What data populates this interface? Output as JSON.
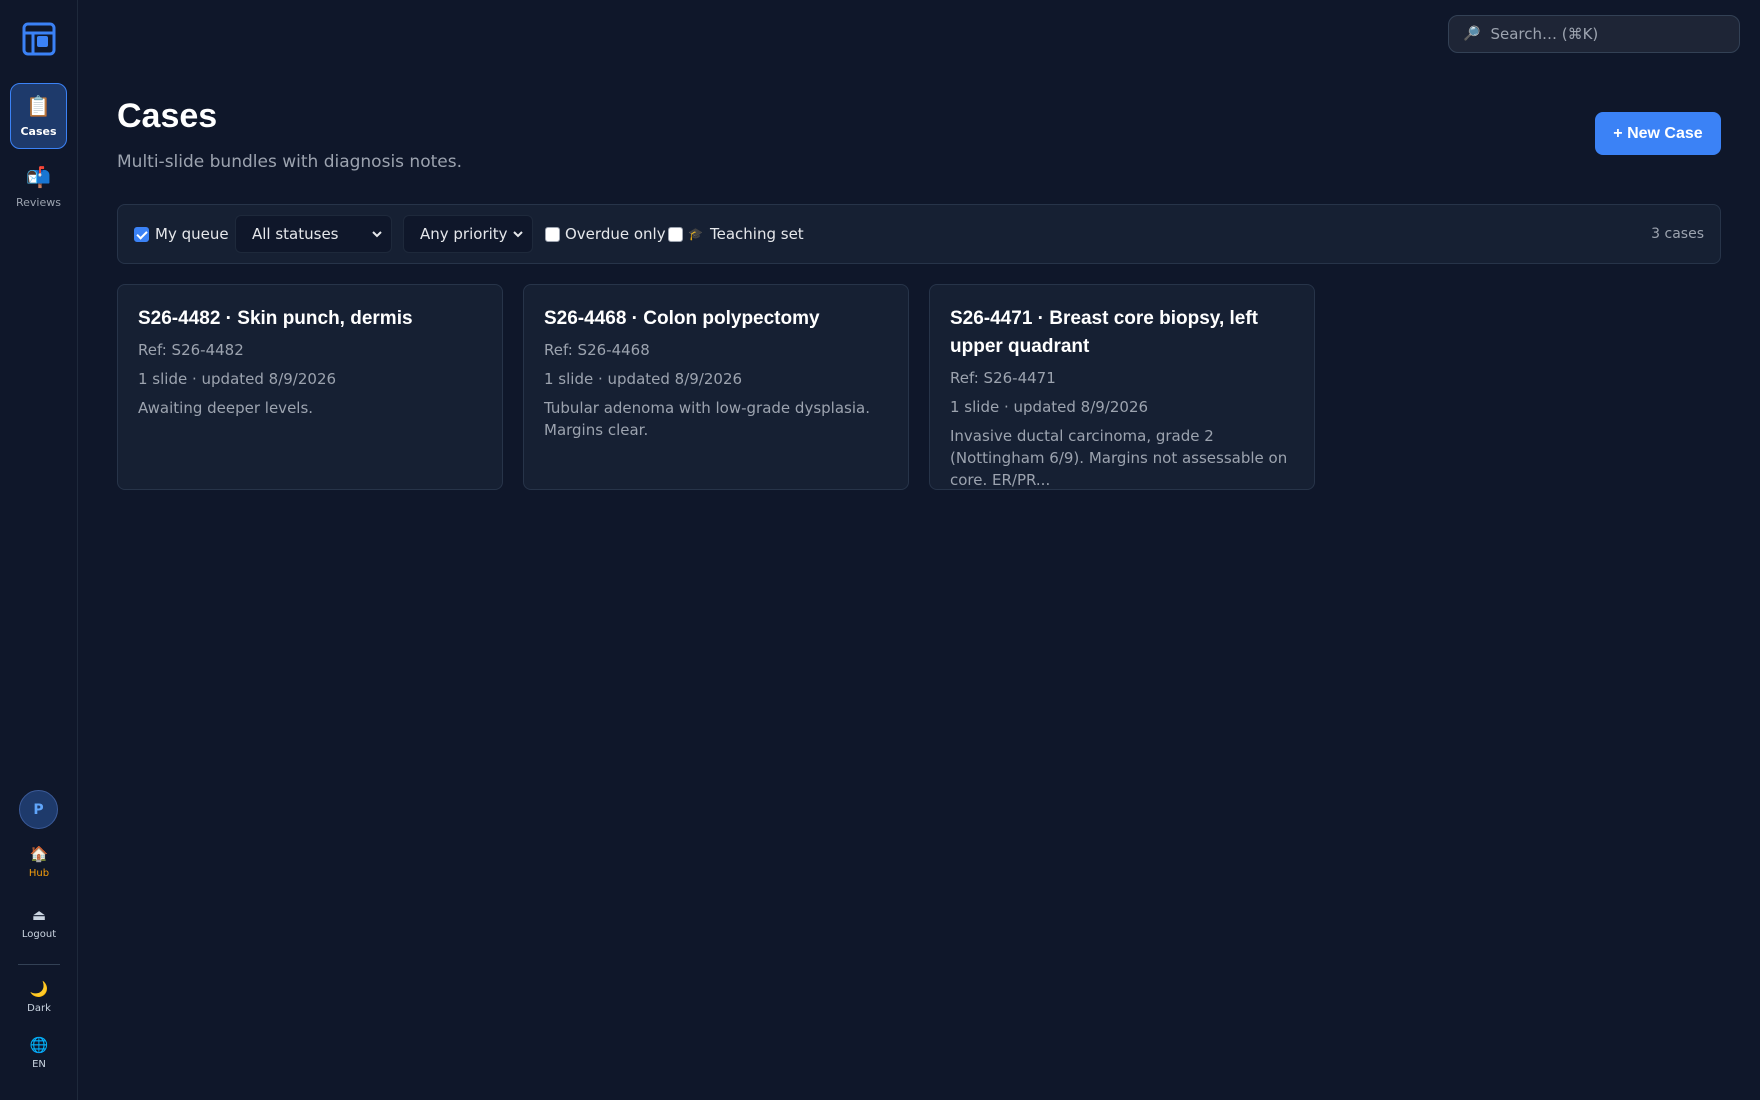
{
  "sidebar": {
    "nav": [
      {
        "label": "Cases",
        "icon": "clipboard-icon",
        "active": true
      },
      {
        "label": "Reviews",
        "icon": "mailbox-icon",
        "active": false
      }
    ],
    "avatar_initial": "P",
    "hub_label": "Hub",
    "logout_label": "Logout",
    "theme_label": "Dark",
    "language_label": "EN"
  },
  "search": {
    "placeholder": "Search…  (⌘K)"
  },
  "header": {
    "title": "Cases",
    "subtitle": "Multi-slide bundles with diagnosis notes.",
    "new_case_label": "+ New Case"
  },
  "filters": {
    "my_queue": {
      "label": "My queue",
      "checked": true
    },
    "status_select": "All statuses",
    "priority_select": "Any priority",
    "overdue": {
      "label": "Overdue only",
      "checked": false
    },
    "teaching": {
      "label": "Teaching set",
      "checked": false
    },
    "count_text": "3 cases"
  },
  "cases": [
    {
      "title": "S26-4482 · Skin punch, dermis",
      "ref": "Ref: S26-4482",
      "meta": "1 slide · updated 8/9/2026",
      "note": "Awaiting deeper levels."
    },
    {
      "title": "S26-4468 · Colon polypectomy",
      "ref": "Ref: S26-4468",
      "meta": "1 slide · updated 8/9/2026",
      "note": "Tubular adenoma with low-grade dysplasia. Margins clear."
    },
    {
      "title": "S26-4471 · Breast core biopsy, left upper quadrant",
      "ref": "Ref: S26-4471",
      "meta": "1 slide · updated 8/9/2026",
      "note": "Invasive ductal carcinoma, grade 2 (Nottingham 6/9). Margins not assessable on core. ER/PR..."
    }
  ],
  "colors": {
    "background": "#0f172a",
    "accent": "#3b82f6",
    "hub": "#f59e0b"
  }
}
